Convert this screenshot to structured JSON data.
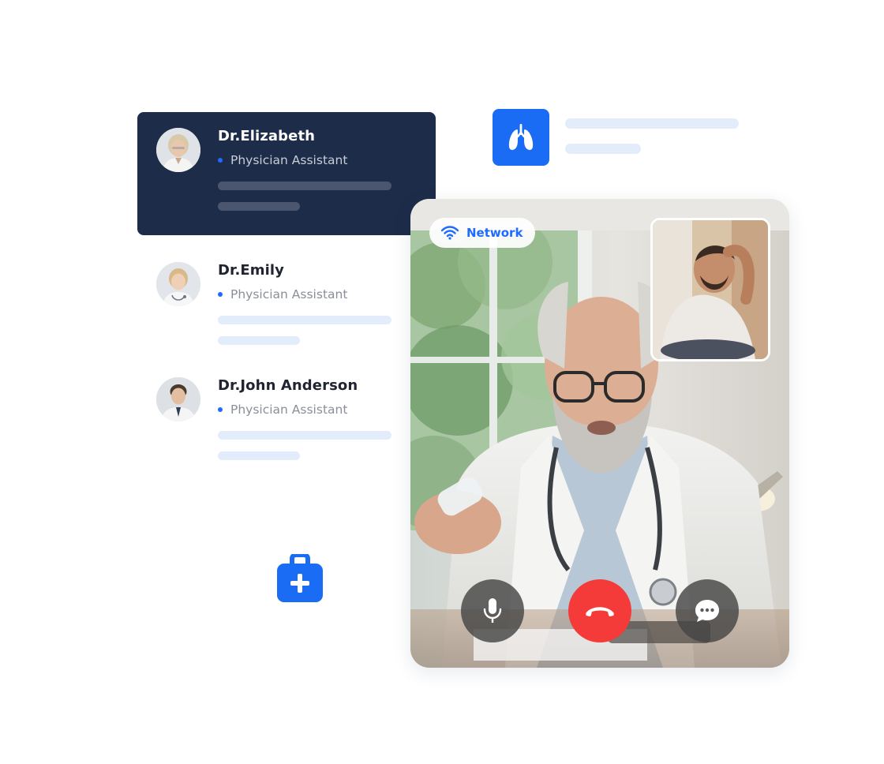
{
  "doctors": [
    {
      "name": "Dr.Elizabeth",
      "role": "Physician Assistant",
      "active": true
    },
    {
      "name": "Dr.Emily",
      "role": "Physician Assistant",
      "active": false
    },
    {
      "name": "Dr.John Anderson",
      "role": "Physician Assistant",
      "active": false
    }
  ],
  "call": {
    "network_label": "Network",
    "icons": {
      "network": "wifi-icon",
      "mic": "microphone-icon",
      "end": "phone-hangup-icon",
      "chat": "chat-bubble-icon"
    }
  },
  "tiles": {
    "lungs_icon": "lungs-icon",
    "medkit_icon": "medical-kit-icon"
  },
  "colors": {
    "accent": "#1a6cf5",
    "active_card": "#1d2d49",
    "end_call": "#f53a3a",
    "placeholder": "#e3ecfb"
  }
}
